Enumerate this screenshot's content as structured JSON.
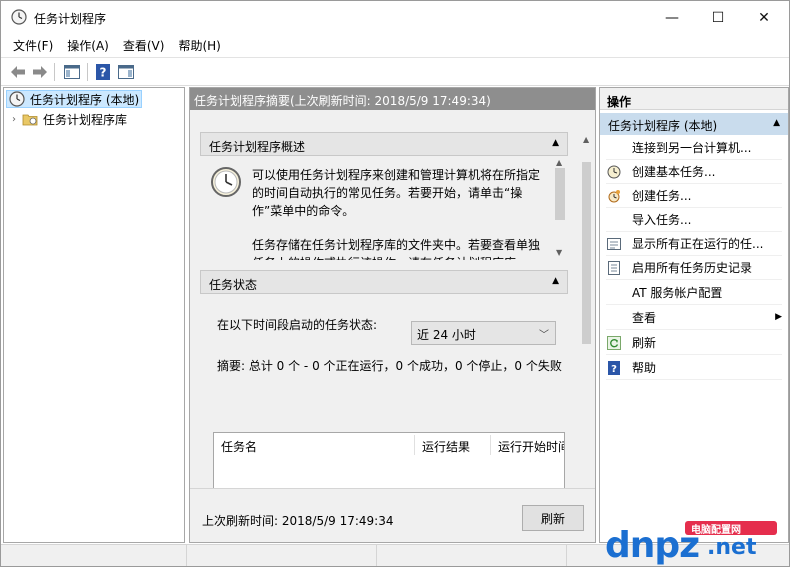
{
  "window": {
    "title": "任务计划程序",
    "controls": {
      "minimize": "—",
      "maximize": "☐",
      "close": "✕"
    }
  },
  "menubar": {
    "items": [
      {
        "label": "文件(F)"
      },
      {
        "label": "操作(A)"
      },
      {
        "label": "查看(V)"
      },
      {
        "label": "帮助(H)"
      }
    ]
  },
  "toolbar": {
    "icons": [
      "back-arrow-icon",
      "forward-arrow-icon",
      "console-tree-icon",
      "help-icon",
      "action-pane-icon"
    ]
  },
  "tree": {
    "root": {
      "label": "任务计划程序 (本地)",
      "icon": "clock-icon"
    },
    "child": {
      "label": "任务计划程序库",
      "icon": "folder-icon"
    }
  },
  "center": {
    "header": "任务计划程序摘要(上次刷新时间: 2018/5/9 17:49:34)",
    "overview": {
      "title": "任务计划程序概述",
      "paragraph1": "可以使用任务计划程序来创建和管理计算机将在所指定的时间自动执行的常见任务。若要开始，请单击“操作”菜单中的命令。",
      "paragraph2": "任务存储在任务计划程序库的文件夹中。若要查看单独任务上的操作或执行该操作，请在任务计划程序库"
    },
    "status": {
      "title": "任务状态",
      "period_label": "在以下时间段启动的任务状态:",
      "period_value": "近 24 小时",
      "summary": "摘要: 总计 0 个 - 0 个正在运行，0 个成功，0 个停止，0 个失败",
      "table_headers": [
        "任务名",
        "运行结果",
        "运行开始时间"
      ]
    },
    "footer": {
      "last_refresh": "上次刷新时间: 2018/5/9 17:49:34",
      "refresh_button": "刷新"
    }
  },
  "actions": {
    "header": "操作",
    "group": "任务计划程序 (本地)",
    "items": [
      {
        "label": "连接到另一台计算机...",
        "icon": ""
      },
      {
        "label": "创建基本任务...",
        "icon": "basic-task-icon"
      },
      {
        "label": "创建任务...",
        "icon": "create-task-icon"
      },
      {
        "label": "导入任务...",
        "icon": ""
      },
      {
        "label": "显示所有正在运行的任...",
        "icon": "running-tasks-icon"
      },
      {
        "label": "启用所有任务历史记录",
        "icon": "history-icon"
      },
      {
        "label": "AT 服务帐户配置",
        "icon": ""
      },
      {
        "label": "查看",
        "icon": ""
      },
      {
        "label": "刷新",
        "icon": "refresh-icon"
      },
      {
        "label": "帮助",
        "icon": "help-icon"
      }
    ]
  },
  "watermark": {
    "logo": "dnpz",
    "domain": ".net",
    "tagline": "电脑配置网"
  },
  "colors": {
    "selection": "#cce8ff",
    "center_header": "#8e8e8e",
    "action_group": "#c9dced",
    "watermark_blue": "#1b6fd1",
    "watermark_red": "#e52e4d"
  }
}
